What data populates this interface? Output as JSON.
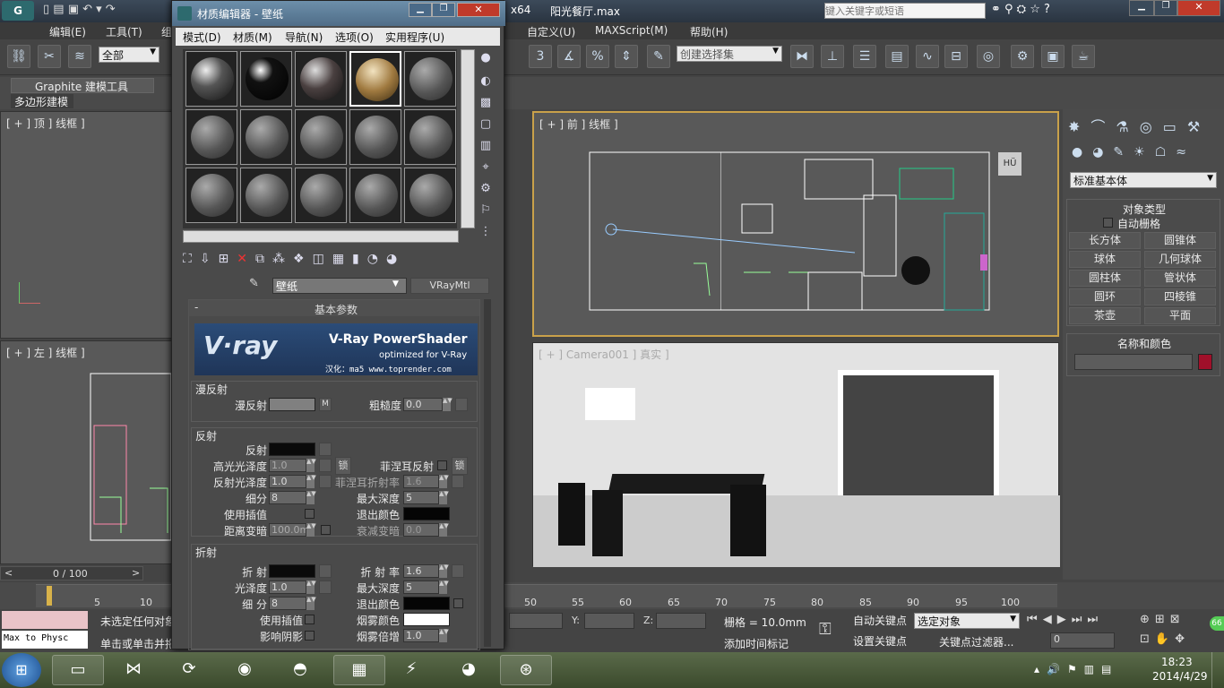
{
  "app": {
    "arch": "x64",
    "file": "阳光餐厅.max",
    "search_placeholder": "键入关键字或短语"
  },
  "menubar": [
    "编辑(E)",
    "工具(T)",
    "组",
    "自定义(U)",
    "MAXScript(M)",
    "帮助(H)"
  ],
  "toolbar": {
    "filter": "全部",
    "selection_set": "创建选择集",
    "snap_angle": "3",
    "snap_percent": "%"
  },
  "ribbon": {
    "tab": "Graphite 建模工具",
    "subtab": "多边形建模"
  },
  "viewports": {
    "top": "[ + ] 顶 ] 线框 ]",
    "front": "[ + ] 前 ] 线框 ]",
    "left": "[ + ] 左 ] 线框 ]",
    "camera": "[ + ] Camera001 ] 真实 ]"
  },
  "cmdpanel": {
    "dropdown": "标准基本体",
    "object_type_title": "对象类型",
    "autogrid": "自动栅格",
    "buttons": [
      "长方体",
      "圆锥体",
      "球体",
      "几何球体",
      "圆柱体",
      "管状体",
      "圆环",
      "四棱锥",
      "茶壶",
      "平面"
    ],
    "name_color_title": "名称和颜色",
    "name_value": ""
  },
  "timeline": {
    "frame": "0 / 100",
    "ticks": [
      "5",
      "10",
      "50",
      "55",
      "60",
      "65",
      "70",
      "75",
      "80",
      "85",
      "90",
      "95",
      "100"
    ]
  },
  "statusbar": {
    "prompt1": "未选定任何对象",
    "prompt2": "单击或单击并拖",
    "maxscript": "Max to Physc",
    "grid": "栅格 = 10.0mm",
    "autokey": "自动关键点",
    "setkey": "设置关键点",
    "selected": "选定对象",
    "keyfilter": "关键点过滤器...",
    "add_time_tag": "添加时间标记",
    "frame_field": "0",
    "x": "X:",
    "y": "Y:",
    "z": "Z:"
  },
  "clock": {
    "time": "18:23",
    "date": "2014/4/29"
  },
  "material_editor": {
    "title": "材质编辑器 - 壁纸",
    "menu": [
      "模式(D)",
      "材质(M)",
      "导航(N)",
      "选项(O)",
      "实用程序(U)"
    ],
    "material_name": "壁纸",
    "material_type": "VRayMtl",
    "rollout": "基本参数",
    "vray_banner": "V-Ray PowerShader",
    "vray_sub": "optimized for V-Ray",
    "vray_credit": "汉化：ma5 www.toprender.com",
    "diffuse_group": "漫反射",
    "diffuse_label": "漫反射",
    "roughness_label": "粗糙度",
    "roughness_value": "0.0",
    "reflect_group": "反射",
    "reflect_label": "反射",
    "hilight_label": "高光光泽度",
    "hilight_value": "1.0",
    "lock_label": "锁",
    "fresnel_label": "菲涅耳反射",
    "refl_gloss_label": "反射光泽度",
    "refl_gloss_value": "1.0",
    "fresnel_ior_label": "菲涅耳折射率",
    "fresnel_ior_value": "1.6",
    "subdiv_label": "细分",
    "subdiv_value": "8",
    "max_depth_label": "最大深度",
    "max_depth_value": "5",
    "use_interp_label": "使用插值",
    "exit_color_label": "退出颜色",
    "dim_dist_label": "距离变暗",
    "dim_dist_value": "100.0m",
    "dim_falloff_label": "衰减变暗",
    "dim_falloff_value": "0.0",
    "refract_group": "折射",
    "refract_label": "折 射",
    "ior_label": "折 射 率",
    "ior_value": "1.6",
    "r_gloss_label": "光泽度",
    "r_gloss_value": "1.0",
    "r_maxdepth_label": "最大深度",
    "r_maxdepth_value": "5",
    "r_subdiv_label": "细 分",
    "r_subdiv_value": "8",
    "r_exit_label": "退出颜色",
    "r_interp_label": "使用插值",
    "fog_color_label": "烟雾颜色",
    "shadows_label": "影响阴影",
    "fog_mult_label": "烟雾倍增",
    "fog_mult_value": "1.0",
    "m_button": "M"
  },
  "colors": {
    "accent": "#c9a14a",
    "vp_active_border": "#c9a14a"
  }
}
